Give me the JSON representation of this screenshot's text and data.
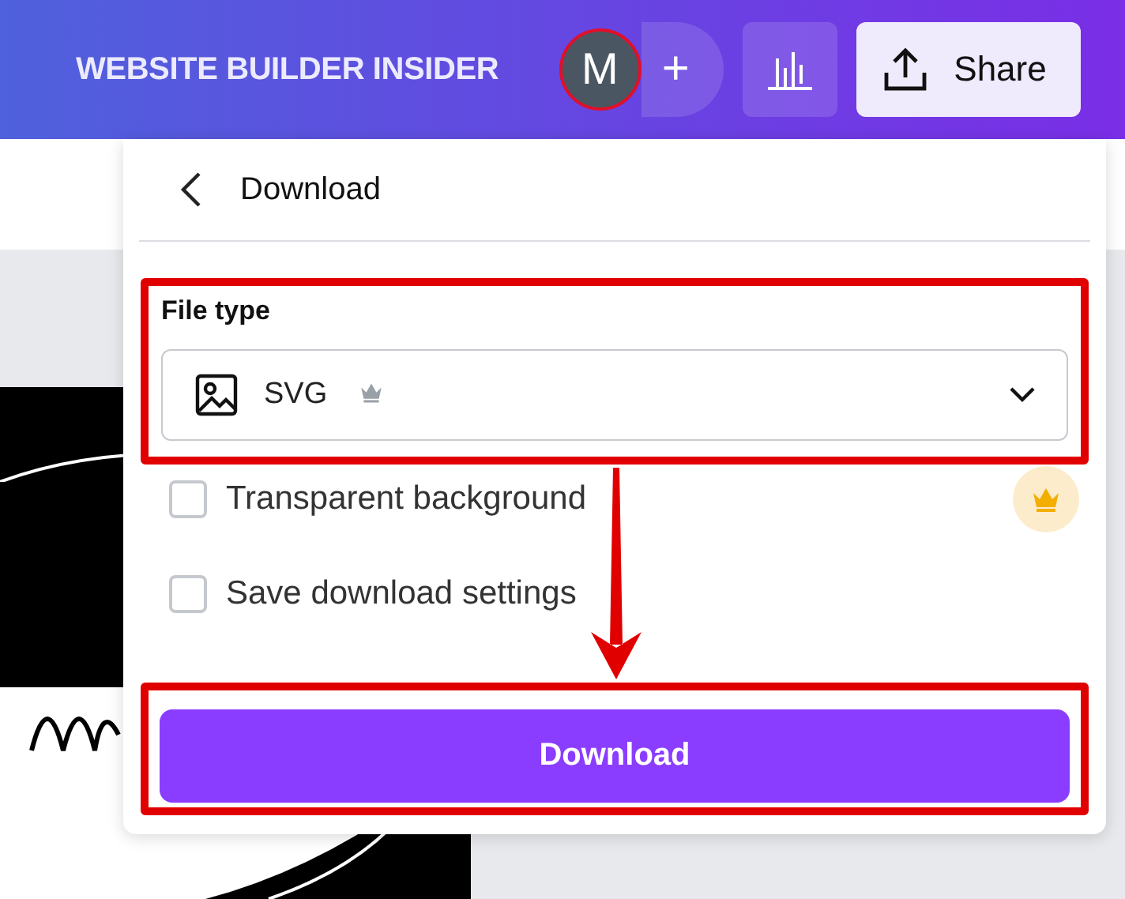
{
  "header": {
    "title": "WEBSITE BUILDER INSIDER",
    "avatar": "M",
    "add": "+",
    "share": "Share"
  },
  "panel": {
    "title": "Download",
    "file_type_label": "File type",
    "file_type": "SVG",
    "file_type_premium": true,
    "options": [
      {
        "label": "Transparent background",
        "checked": false,
        "premium": true
      },
      {
        "label": "Save download settings",
        "checked": false,
        "premium": false
      }
    ],
    "button": "Download"
  }
}
